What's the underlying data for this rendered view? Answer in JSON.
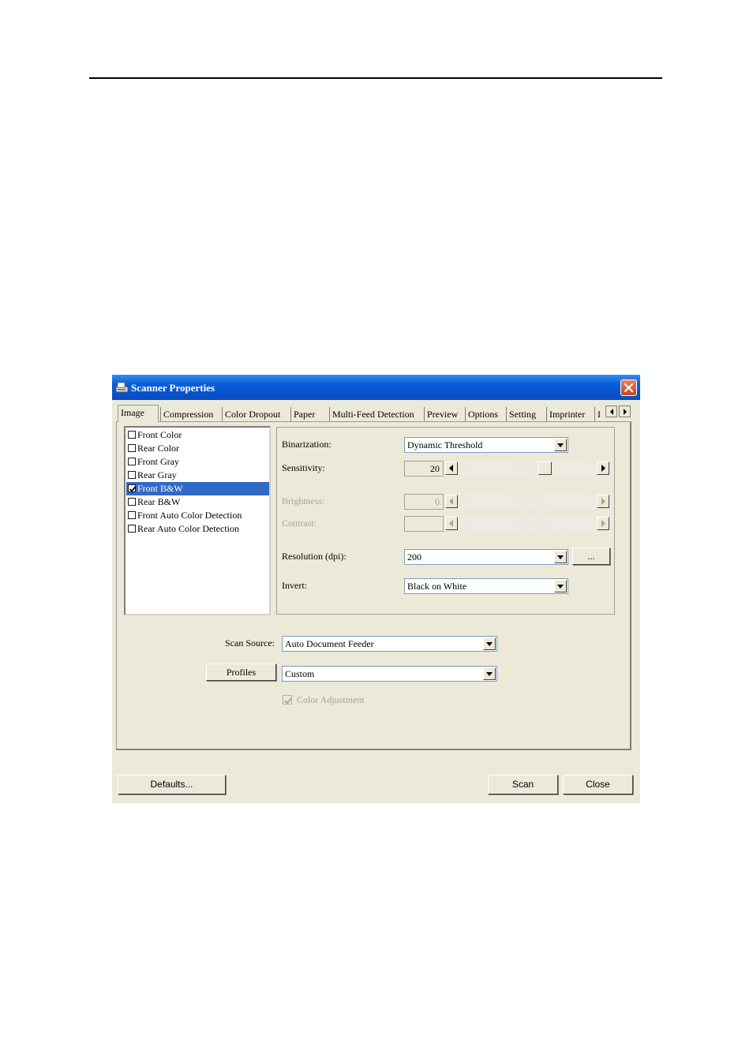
{
  "window": {
    "title": "Scanner Properties",
    "icon": "scanner-icon",
    "close_icon": "close-icon"
  },
  "tabs": [
    "Image",
    "Compression",
    "Color Dropout",
    "Paper",
    "Multi-Feed Detection",
    "Preview",
    "Options",
    "Setting",
    "Imprinter",
    "I"
  ],
  "active_tab": "Image",
  "image_list": [
    {
      "label": "Front Color",
      "checked": false
    },
    {
      "label": "Rear Color",
      "checked": false
    },
    {
      "label": "Front Gray",
      "checked": false
    },
    {
      "label": "Rear Gray",
      "checked": false
    },
    {
      "label": "Front B&W",
      "checked": true,
      "selected": true
    },
    {
      "label": "Rear B&W",
      "checked": false
    },
    {
      "label": "Front Auto Color Detection",
      "checked": false
    },
    {
      "label": "Rear Auto Color Detection",
      "checked": false
    }
  ],
  "settings": {
    "binarization_label": "Binarization:",
    "binarization_value": "Dynamic Threshold",
    "sensitivity_label": "Sensitivity:",
    "sensitivity_value": "20",
    "brightness_label": "Brightness:",
    "brightness_value": "0",
    "contrast_label": "Contrast:",
    "contrast_value": "",
    "resolution_label": "Resolution (dpi):",
    "resolution_value": "200",
    "resolution_more": "...",
    "invert_label": "Invert:",
    "invert_value": "Black on White"
  },
  "scan_source": {
    "label": "Scan Source:",
    "value": "Auto Document Feeder"
  },
  "profiles": {
    "button": "Profiles",
    "value": "Custom"
  },
  "color_adjustment": {
    "label": "Color Adjustment",
    "checked": true,
    "enabled": false
  },
  "footer": {
    "defaults": "Defaults...",
    "scan": "Scan",
    "close": "Close"
  },
  "colors": {
    "title_bar": "#0a5fd8",
    "selection": "#316ac5",
    "dialog_bg": "#ece9d8"
  }
}
